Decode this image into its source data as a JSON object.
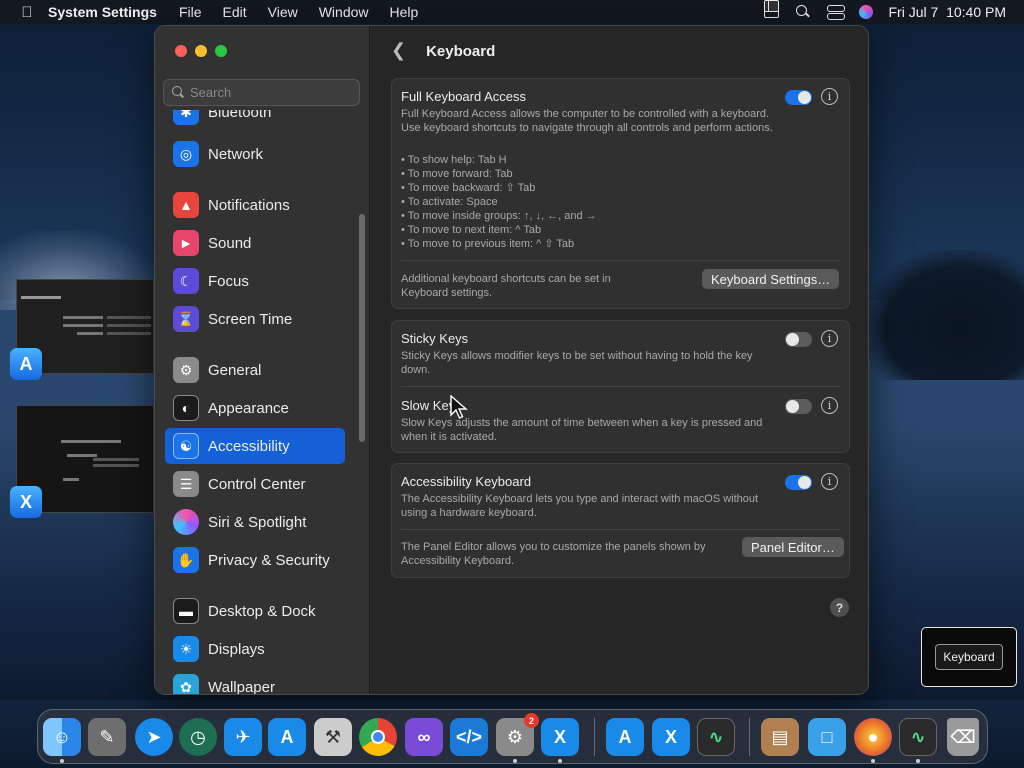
{
  "menubar": {
    "app_name": "System Settings",
    "menus": [
      "File",
      "Edit",
      "View",
      "Window",
      "Help"
    ],
    "clock": "Fri Jul 7  10:40 PM"
  },
  "sidebar": {
    "search_placeholder": "Search",
    "items": [
      {
        "label": "Bluetooth",
        "icon": "bluetooth-icon",
        "color": "#1a73e8"
      },
      {
        "label": "Network",
        "icon": "globe-icon",
        "color": "#1a73e8"
      },
      {
        "label": "Notifications",
        "icon": "bell-icon",
        "color": "#e8453c"
      },
      {
        "label": "Sound",
        "icon": "speaker-icon",
        "color": "#e8456a"
      },
      {
        "label": "Focus",
        "icon": "moon-icon",
        "color": "#5b4bd6"
      },
      {
        "label": "Screen Time",
        "icon": "hourglass-icon",
        "color": "#5b4bd6"
      },
      {
        "label": "General",
        "icon": "gear-icon",
        "color": "#8a8a8a"
      },
      {
        "label": "Appearance",
        "icon": "appearance-icon",
        "color": "#1b1b1b"
      },
      {
        "label": "Accessibility",
        "icon": "accessibility-icon",
        "color": "#1a73e8"
      },
      {
        "label": "Control Center",
        "icon": "control-center-icon",
        "color": "#8a8a8a"
      },
      {
        "label": "Siri & Spotlight",
        "icon": "siri-icon",
        "color": "#8a3ad6"
      },
      {
        "label": "Privacy & Security",
        "icon": "hand-icon",
        "color": "#1a73e8"
      },
      {
        "label": "Desktop & Dock",
        "icon": "dock-icon",
        "color": "#1b1b1b"
      },
      {
        "label": "Displays",
        "icon": "sun-icon",
        "color": "#1a8ae8"
      },
      {
        "label": "Wallpaper",
        "icon": "wallpaper-icon",
        "color": "#2aa4d6"
      }
    ]
  },
  "content": {
    "title": "Keyboard",
    "full_keyboard_access": {
      "title": "Full Keyboard Access",
      "enabled": true,
      "description": "Full Keyboard Access allows the computer to be controlled with a keyboard. Use keyboard shortcuts to navigate through all controls and perform actions.",
      "bullets": [
        "• To show help: Tab H",
        "• To move forward: Tab",
        "• To move backward: ⇧ Tab",
        "• To activate: Space",
        "• To move inside groups: ↑, ↓, ←, and →",
        "• To move to next item: ^ Tab",
        "• To move to previous item: ^ ⇧ Tab"
      ],
      "footer_text": "Additional keyboard shortcuts can be set in Keyboard settings.",
      "button_label": "Keyboard Settings…"
    },
    "sticky_keys": {
      "title": "Sticky Keys",
      "enabled": false,
      "description": "Sticky Keys allows modifier keys to be set without having to hold the key down."
    },
    "slow_keys": {
      "title": "Slow Keys",
      "enabled": false,
      "description": "Slow Keys adjusts the amount of time between when a key is pressed and when it is activated."
    },
    "accessibility_keyboard": {
      "title": "Accessibility Keyboard",
      "enabled": true,
      "description": "The Accessibility Keyboard lets you type and interact with macOS without using a hardware keyboard.",
      "footer_text": "The Panel Editor allows you to customize the panels shown by Accessibility Keyboard.",
      "button_label": "Panel Editor…"
    },
    "help_label": "?"
  },
  "hud": {
    "key_label": "Keyboard"
  },
  "dock": {
    "items": [
      {
        "name": "finder",
        "color": "#2d8ae8",
        "running": true
      },
      {
        "name": "launchpad-notes",
        "color": "#777777",
        "running": false
      },
      {
        "name": "safari",
        "color": "#1a8ae8",
        "running": false
      },
      {
        "name": "time-machine",
        "color": "#1e6e54",
        "running": false
      },
      {
        "name": "testflight",
        "color": "#1a8ae8",
        "running": false
      },
      {
        "name": "app-store",
        "color": "#1a8ae8",
        "running": false
      },
      {
        "name": "instruments",
        "color": "#cccccc",
        "running": false
      },
      {
        "name": "chrome",
        "color": "#e8e8e8",
        "running": false
      },
      {
        "name": "visual-studio",
        "color": "#7a4bd6",
        "running": false
      },
      {
        "name": "vscode",
        "color": "#1a7ad6",
        "running": false
      },
      {
        "name": "system-settings",
        "color": "#8a8a8a",
        "running": true,
        "badge": "2"
      },
      {
        "name": "xcode",
        "color": "#1a8ae8",
        "running": true
      },
      {
        "name": "app-store-2",
        "color": "#1a8ae8",
        "running": false
      },
      {
        "name": "xcode-2",
        "color": "#1a8ae8",
        "running": false
      },
      {
        "name": "activity-monitor",
        "color": "#2a2a2a",
        "running": false
      },
      {
        "name": "archive-utility",
        "color": "#b08050",
        "running": false
      },
      {
        "name": "downloads-folder",
        "color": "#3aa0e8",
        "running": false
      },
      {
        "name": "firefox",
        "color": "#e86a2a",
        "running": true
      },
      {
        "name": "activity-monitor-2",
        "color": "#2a2a2a",
        "running": true
      },
      {
        "name": "trash",
        "color": "#9a9a9a",
        "running": false
      }
    ]
  }
}
